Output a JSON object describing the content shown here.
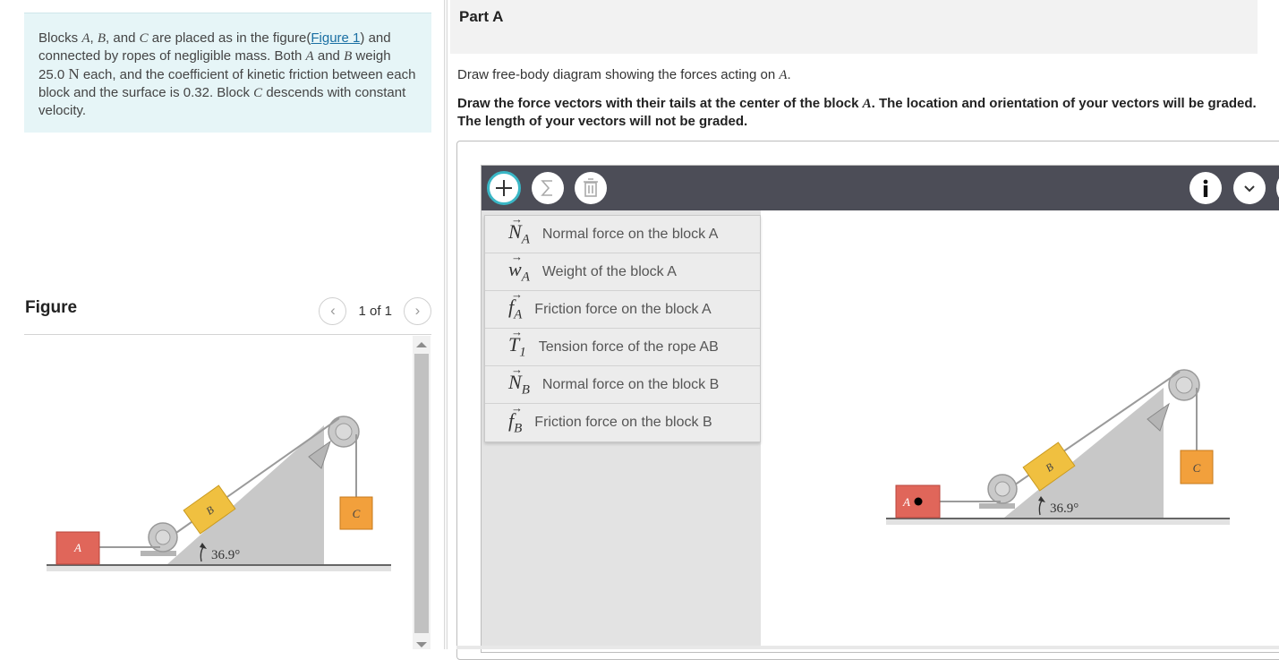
{
  "problem": {
    "segments": [
      {
        "t": "Blocks ",
        "style": "plain"
      },
      {
        "t": "A",
        "style": "italic"
      },
      {
        "t": ", ",
        "style": "plain"
      },
      {
        "t": "B",
        "style": "italic"
      },
      {
        "t": ", and ",
        "style": "plain"
      },
      {
        "t": "C",
        "style": "italic"
      },
      {
        "t": " are placed as in the figure(",
        "style": "plain"
      },
      {
        "t": "Figure 1",
        "style": "link"
      },
      {
        "t": ") and connected by ropes of negligible mass. Both ",
        "style": "plain"
      },
      {
        "t": "A",
        "style": "italic"
      },
      {
        "t": " and ",
        "style": "plain"
      },
      {
        "t": "B",
        "style": "italic"
      },
      {
        "t": " weigh 25.0 ",
        "style": "plain"
      },
      {
        "t": "N",
        "style": "unit"
      },
      {
        "t": " each, and the coefficient of kinetic friction between each block and the surface is 0.32. Block ",
        "style": "plain"
      },
      {
        "t": "C",
        "style": "italic"
      },
      {
        "t": " descends with constant velocity.",
        "style": "plain"
      }
    ]
  },
  "figure_panel": {
    "title": "Figure",
    "page_count": "1 of 1",
    "prev_icon": "chevron-left-icon",
    "next_icon": "chevron-right-icon"
  },
  "diagram": {
    "block_a": "A",
    "block_b": "B",
    "block_c": "C",
    "angle_label": "36.9°"
  },
  "part": {
    "title": "Part A",
    "instruction_1": "Draw free-body diagram showing the forces acting on ",
    "instruction_1_var": "A",
    "instruction_1_end": ".",
    "instruction_2_a": "Draw the force vectors with their tails at the center of the block ",
    "instruction_2_var": "A",
    "instruction_2_b": ". The location and orientation of your vectors will be graded. The length of your vectors will not be graded."
  },
  "toolbar": {
    "add_icon": "plus-icon",
    "sum_icon": "sigma-icon",
    "delete_icon": "trash-icon",
    "info_icon": "info-icon",
    "more_icon": "chevron-down-icon"
  },
  "vectors": [
    {
      "symbol": "N",
      "sub": "A",
      "label": "Normal force on the block A"
    },
    {
      "symbol": "w",
      "sub": "A",
      "label": "Weight of the block A"
    },
    {
      "symbol": "f",
      "sub": "A",
      "label": "Friction force on the block A"
    },
    {
      "symbol": "T",
      "sub": "1",
      "label": "Tension force of the rope AB"
    },
    {
      "symbol": "N",
      "sub": "B",
      "label": "Normal force on the block B"
    },
    {
      "symbol": "f",
      "sub": "B",
      "label": "Friction force on the block B"
    }
  ],
  "colors": {
    "block_a": "#e0665a",
    "block_b": "#f0c040",
    "block_c": "#f2a03c",
    "ramp": "#c8c8c8",
    "toolbar": "#4c4d57",
    "accent": "#3ab7c6"
  }
}
